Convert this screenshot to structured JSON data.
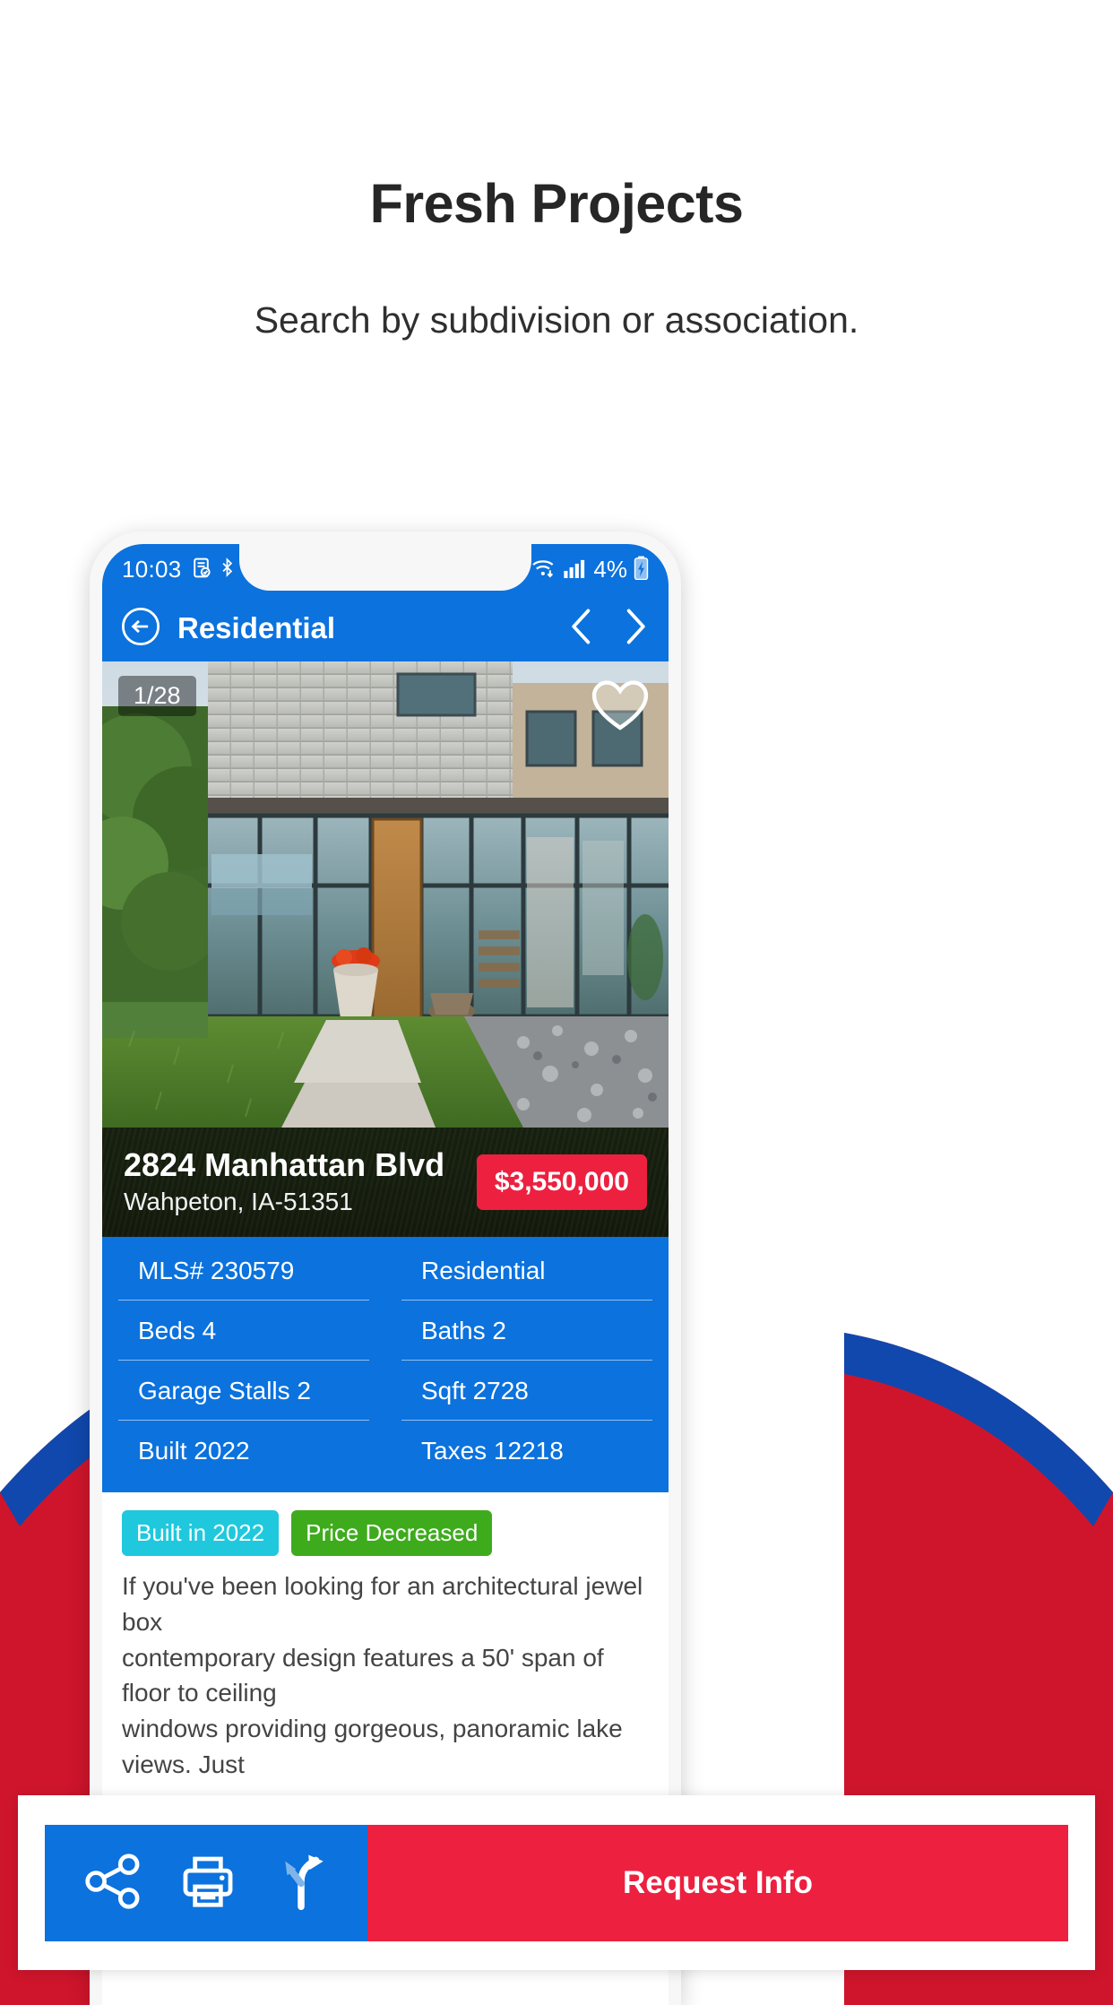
{
  "hero": {
    "title": "Fresh Projects",
    "subtitle": "Search by subdivision or association."
  },
  "colors": {
    "brand_blue": "#0b72de",
    "brand_red": "#ed2040",
    "deco_red": "#cf152c",
    "deco_blue": "#1048ad",
    "badge_cyan": "#1fc8dd",
    "badge_green": "#3eab1d",
    "heading_text": "#262626"
  },
  "phone": {
    "status_bar": {
      "time": "10:03",
      "battery_percent": "4%",
      "icons": [
        "document-check-icon",
        "bluetooth-icon",
        "wifi-icon",
        "signal-bars-icon",
        "battery-charging-icon"
      ]
    },
    "app_bar": {
      "back_label": "back-arrow",
      "title": "Residential",
      "prev_label": "previous-listing",
      "next_label": "next-listing"
    },
    "photo": {
      "counter": "1/28",
      "favorite_icon": "heart-icon"
    },
    "listing": {
      "address": "2824 Manhattan Blvd",
      "city_state_zip": "Wahpeton, IA-51351",
      "price": "$3,550,000"
    },
    "details": [
      {
        "left": "MLS# 230579",
        "right": "Residential"
      },
      {
        "left": "Beds 4",
        "right": "Baths 2"
      },
      {
        "left": "Garage Stalls 2",
        "right": "Sqft 2728"
      },
      {
        "left": "Built 2022",
        "right": "Taxes 12218"
      }
    ],
    "badges": [
      {
        "label": "Built in 2022",
        "color": "cyan"
      },
      {
        "label": "Price Decreased",
        "color": "green"
      }
    ],
    "description": {
      "line1": "If you've been looking for an architectural jewel box",
      "line2": "contemporary design features a 50' span of floor to ceiling",
      "line3": "windows providing gorgeous, panoramic lake views. Just"
    }
  },
  "action_bar": {
    "share_icon": "share-icon",
    "print_icon": "print-icon",
    "directions_icon": "directions-icon",
    "request_label": "Request Info"
  }
}
